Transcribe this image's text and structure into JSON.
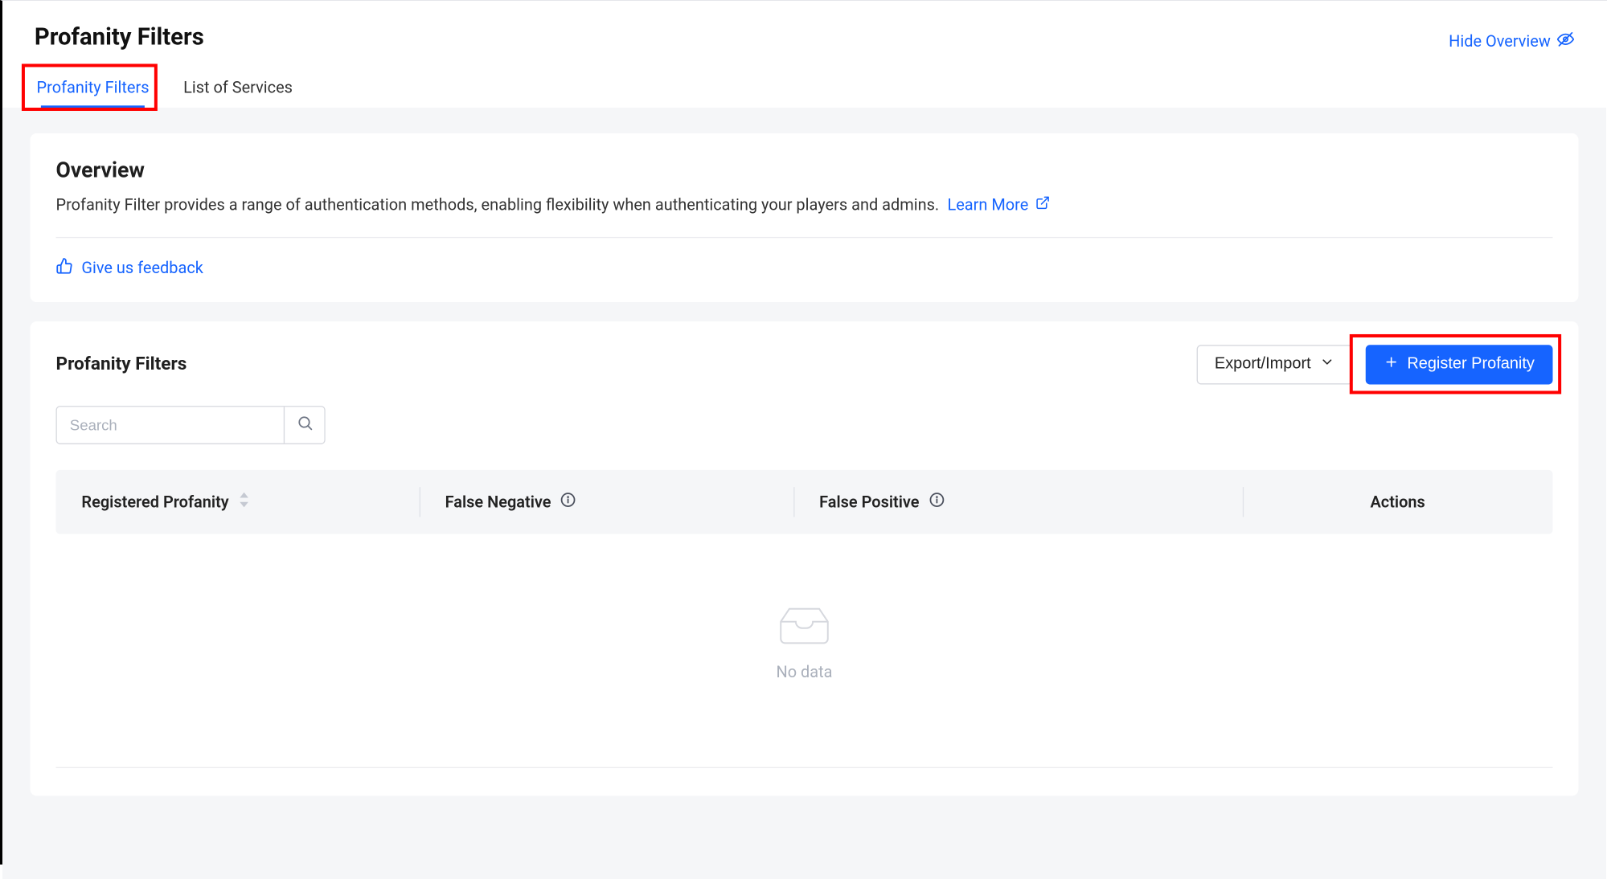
{
  "header": {
    "title": "Profanity Filters",
    "hide_overview": "Hide Overview"
  },
  "tabs": [
    {
      "label": "Profanity Filters",
      "active": true
    },
    {
      "label": "List of Services",
      "active": false
    }
  ],
  "overview": {
    "title": "Overview",
    "description": "Profanity Filter provides a range of authentication methods, enabling flexibility when authenticating your players and admins.",
    "learn_more": "Learn More",
    "feedback": "Give us feedback"
  },
  "filters_panel": {
    "title": "Profanity Filters",
    "export_import": "Export/Import",
    "register": "Register Profanity",
    "search_placeholder": "Search",
    "columns": {
      "registered": "Registered Profanity",
      "false_negative": "False Negative",
      "false_positive": "False Positive",
      "actions": "Actions"
    },
    "no_data": "No data"
  }
}
